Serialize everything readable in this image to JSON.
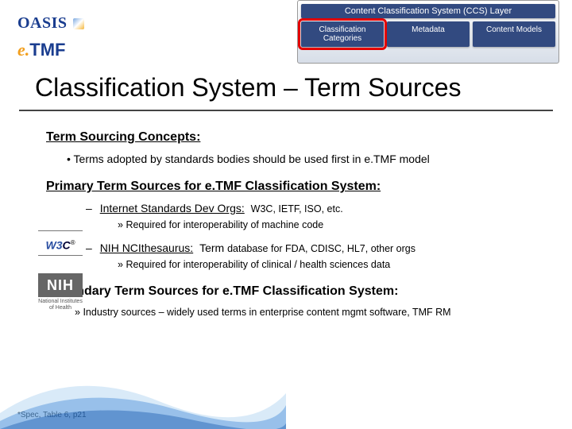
{
  "logos": {
    "oasis": "OASIS",
    "etmf_e": "e.",
    "etmf_tmf": "TMF",
    "w3c_w3": "W3",
    "w3c_c": "C",
    "w3c_reg": "®",
    "nih": "NIH",
    "nih_sub": "National Institutes of Health"
  },
  "ccs": {
    "layer": "Content Classification System (CCS) Layer",
    "tabs": [
      "Classification Categories",
      "Metadata",
      "Content Models"
    ]
  },
  "title": "Classification System – Term Sources",
  "concepts": {
    "heading": "Term Sourcing Concepts:",
    "bullet": "Terms adopted by standards bodies should be used first in e.TMF model"
  },
  "primary": {
    "heading": "Primary Term Sources for e.TMF Classification System:",
    "src1_label": "Internet Standards Dev Orgs:",
    "src1_detail": "W3C, IETF, ISO, etc.",
    "src1_sub": "Required for interoperability of machine code",
    "src2_label": "NIH NCIthesaurus:",
    "src2_detail_prefix": "Term ",
    "src2_detail": "database for FDA, CDISC, HL7, other orgs",
    "src2_sub": "Required for interoperability of clinical / health sciences data"
  },
  "secondary": {
    "heading": "Secondary Term Sources for e.TMF Classification System:",
    "bullet": "Industry sources – widely used terms in enterprise content mgmt software, TMF RM"
  },
  "footnote": "*Spec, Table 6, p21",
  "dash": "–"
}
